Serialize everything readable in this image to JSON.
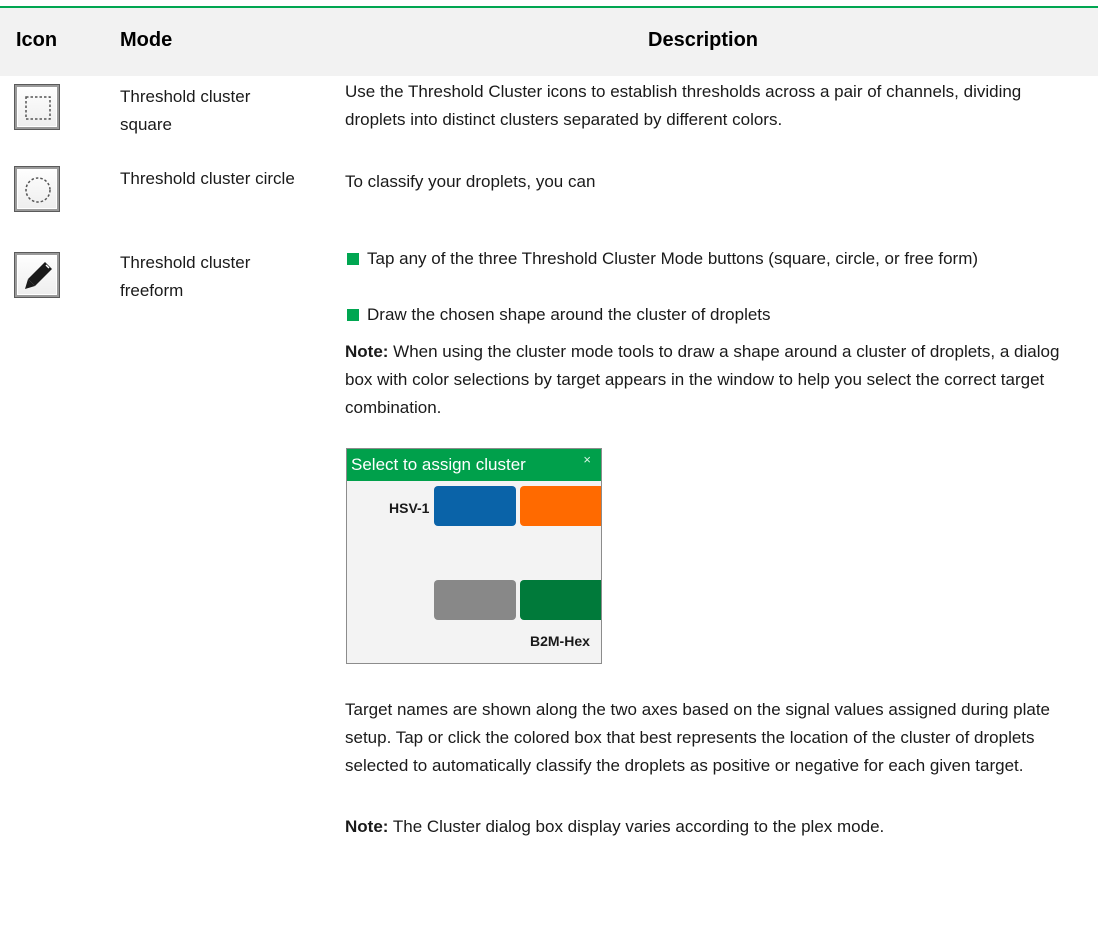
{
  "table": {
    "headers": {
      "icon": "Icon",
      "mode": "Mode",
      "description": "Description"
    },
    "rows": [
      {
        "icon": "threshold-square-icon",
        "mode": "Threshold cluster square"
      },
      {
        "icon": "threshold-circle-icon",
        "mode": "Threshold cluster circle"
      },
      {
        "icon": "threshold-freeform-icon",
        "mode": "Threshold cluster freeform"
      }
    ]
  },
  "description": {
    "intro": "Use the Threshold Cluster icons to establish thresholds across a pair of channels, dividing droplets into distinct clusters separated by different colors.",
    "classify_intro": "To classify your droplets, you can",
    "bullets": [
      "Tap any of the three Threshold Cluster Mode buttons (square, circle, or free form)",
      "Draw the chosen shape around the cluster of droplets"
    ],
    "note1": {
      "label": "Note:",
      "text": " When using the cluster mode tools to draw a shape around a cluster of droplets, a dialog box with color selections by target appears in the window to help you select the correct target combination."
    },
    "dialog": {
      "title": "Select to assign cluster",
      "close": "×",
      "row_label": "HSV-1",
      "column_label": "B2M-Hex",
      "colors": {
        "top_left": "#0a63a8",
        "top_right": "#ff6a00",
        "bottom_left": "#888888",
        "bottom_right": "#007a3a",
        "title_bar": "#00a04b"
      }
    },
    "target_text": "Target names are shown along the two axes based on the signal values assigned during plate setup. Tap or click the colored box that best represents the location of the cluster of droplets selected to automatically classify the droplets as positive or negative for each given target.",
    "note2": {
      "label": "Note:",
      "text": " The Cluster dialog box display varies according to the plex mode."
    }
  },
  "colors": {
    "accent": "#00a651",
    "header_bg": "#f2f2f2"
  }
}
